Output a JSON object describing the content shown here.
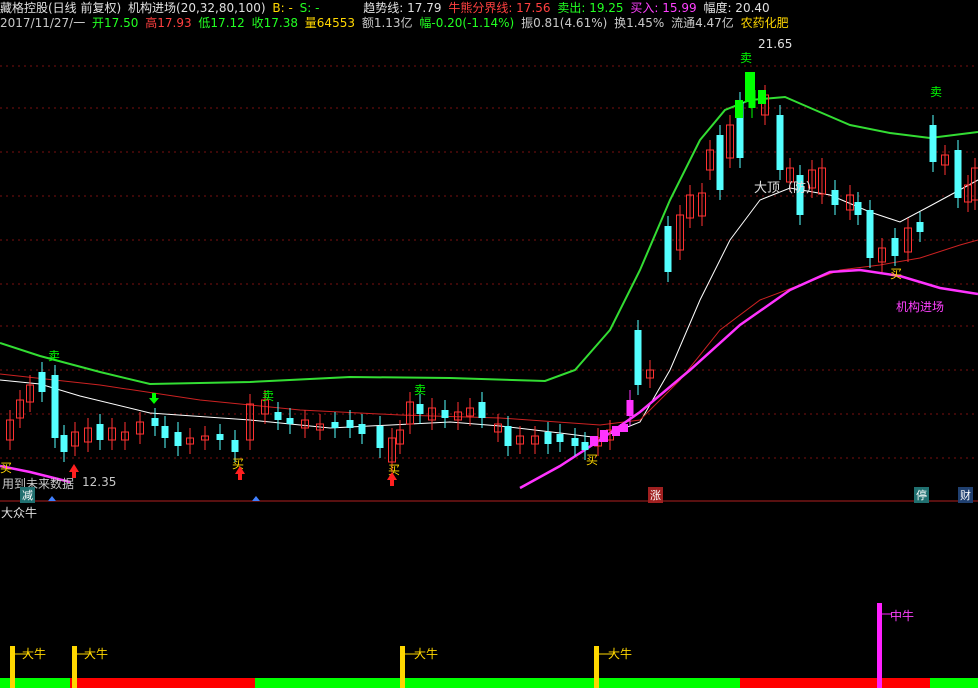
{
  "header1": {
    "title": "藏格控股(日线 前复权)",
    "indicator": "机构进场(20,32,80,100)",
    "b": "B: -",
    "s": "S: -",
    "trend": "趋势线: 17.79",
    "bullbear": "牛熊分界线: 17.56",
    "sell": "卖出: 19.25",
    "buy": "买入: 15.99",
    "amp": "幅度: 20.40"
  },
  "header2": {
    "date": "2017/11/27/一",
    "open": "开17.50",
    "high": "高17.93",
    "low": "低17.12",
    "close": "收17.38",
    "volume": "量64553",
    "amount": "额1.13亿",
    "change": "幅-0.20(-1.14%)",
    "swing": "振0.81(4.61%)",
    "turnover": "换1.45%",
    "float": "流通4.47亿",
    "sector": "农药化肥"
  },
  "annotations": {
    "peak": "21.65",
    "top": "大顶（防）",
    "inst": "机构进场",
    "low_price": "12.35",
    "future": "用到未来数据",
    "sell_mark": "卖",
    "buy_mark": "买",
    "reduce": "减",
    "rise": "涨",
    "stop": "停",
    "cai": "财"
  },
  "lower_panel": {
    "title": "大众牛",
    "big_bull": "大牛",
    "mid_bull": "中牛"
  },
  "colors": {
    "bg": "#000000",
    "up": "#ff3232",
    "down": "#54ffff",
    "upper_band": "#33dd33",
    "inst_line": "#ff33ff",
    "mid_line": "#ffffff",
    "bullbear_line": "#cc2222",
    "bar_red": "#ff0000",
    "bar_green": "#00ff00"
  },
  "chart_data": {
    "type": "candlestick",
    "peak_price": 21.65,
    "low_price": 12.35,
    "current": {
      "open": 17.5,
      "high": 17.93,
      "low": 17.12,
      "close": 17.38
    }
  }
}
